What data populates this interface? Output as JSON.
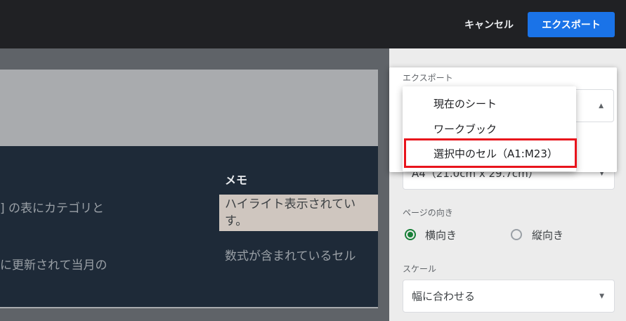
{
  "toolbar": {
    "cancel_label": "キャンセル",
    "export_label": "エクスポート"
  },
  "preview": {
    "column_header": "メモ",
    "left_row1": "] の表にカテゴリと",
    "left_row2": "に更新されて当月の",
    "memo_row1": "ハイライト表示されてい す。",
    "memo_row2": "数式が含まれているセル"
  },
  "panel": {
    "export_label": "エクスポート",
    "export_menu": {
      "items": [
        "現在のシート",
        "ワークブック",
        "選択中のセル（A1:M23）"
      ],
      "selected_index": 2
    },
    "paper_size_value": "A4（21.0cm x 29.7cm）",
    "orientation": {
      "label": "ページの向き",
      "options": [
        "横向き",
        "縦向き"
      ],
      "selected": "横向き"
    },
    "scale": {
      "label": "スケール",
      "value": "幅に合わせる"
    }
  },
  "colors": {
    "accent": "#1a73e8",
    "radio_on": "#188038",
    "highlight_box": "#e8141c"
  },
  "icons": {
    "dropdown_up": "triangle-up",
    "dropdown_down": "triangle-down"
  }
}
